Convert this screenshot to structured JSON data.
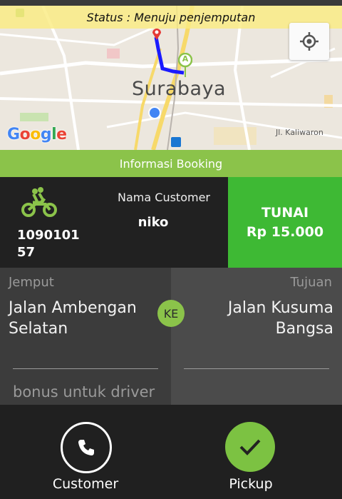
{
  "status": "Status : Menuju penjemputan",
  "map": {
    "city_label": "Surabaya",
    "street_label": "Jl. Kaliwaron",
    "logo_letters": [
      "G",
      "o",
      "o",
      "g",
      "l",
      "e"
    ],
    "logo_colors": [
      "#4285f4",
      "#ea4335",
      "#fbbc05",
      "#4285f4",
      "#34a853",
      "#ea4335"
    ],
    "marker_a_label": "A",
    "route_color": "#1a1aff",
    "icons": [
      "location-target-icon",
      "destination-pin-icon",
      "pickup-marker-icon",
      "current-position-dot",
      "bus-stop-icon"
    ]
  },
  "booking": {
    "header": "Informasi Booking",
    "order_id": "109010157",
    "customer_label": "Nama Customer",
    "customer_name": "niko",
    "payment_method": "TUNAI",
    "payment_amount": "Rp 15.000",
    "vehicle_icon": "motorbike-icon"
  },
  "pickup": {
    "label": "Jemput",
    "address": "Jalan Ambengan Selatan",
    "bonus_placeholder": "bonus untuk driver"
  },
  "destination": {
    "label": "Tujuan",
    "address": "Jalan Kusuma Bangsa"
  },
  "connector": "KE",
  "actions": {
    "call_label": "Customer",
    "pickup_label": "Pickup"
  },
  "colors": {
    "accent_green": "#8bc34a",
    "pay_green": "#3eb934",
    "dark_bg": "#212121"
  }
}
